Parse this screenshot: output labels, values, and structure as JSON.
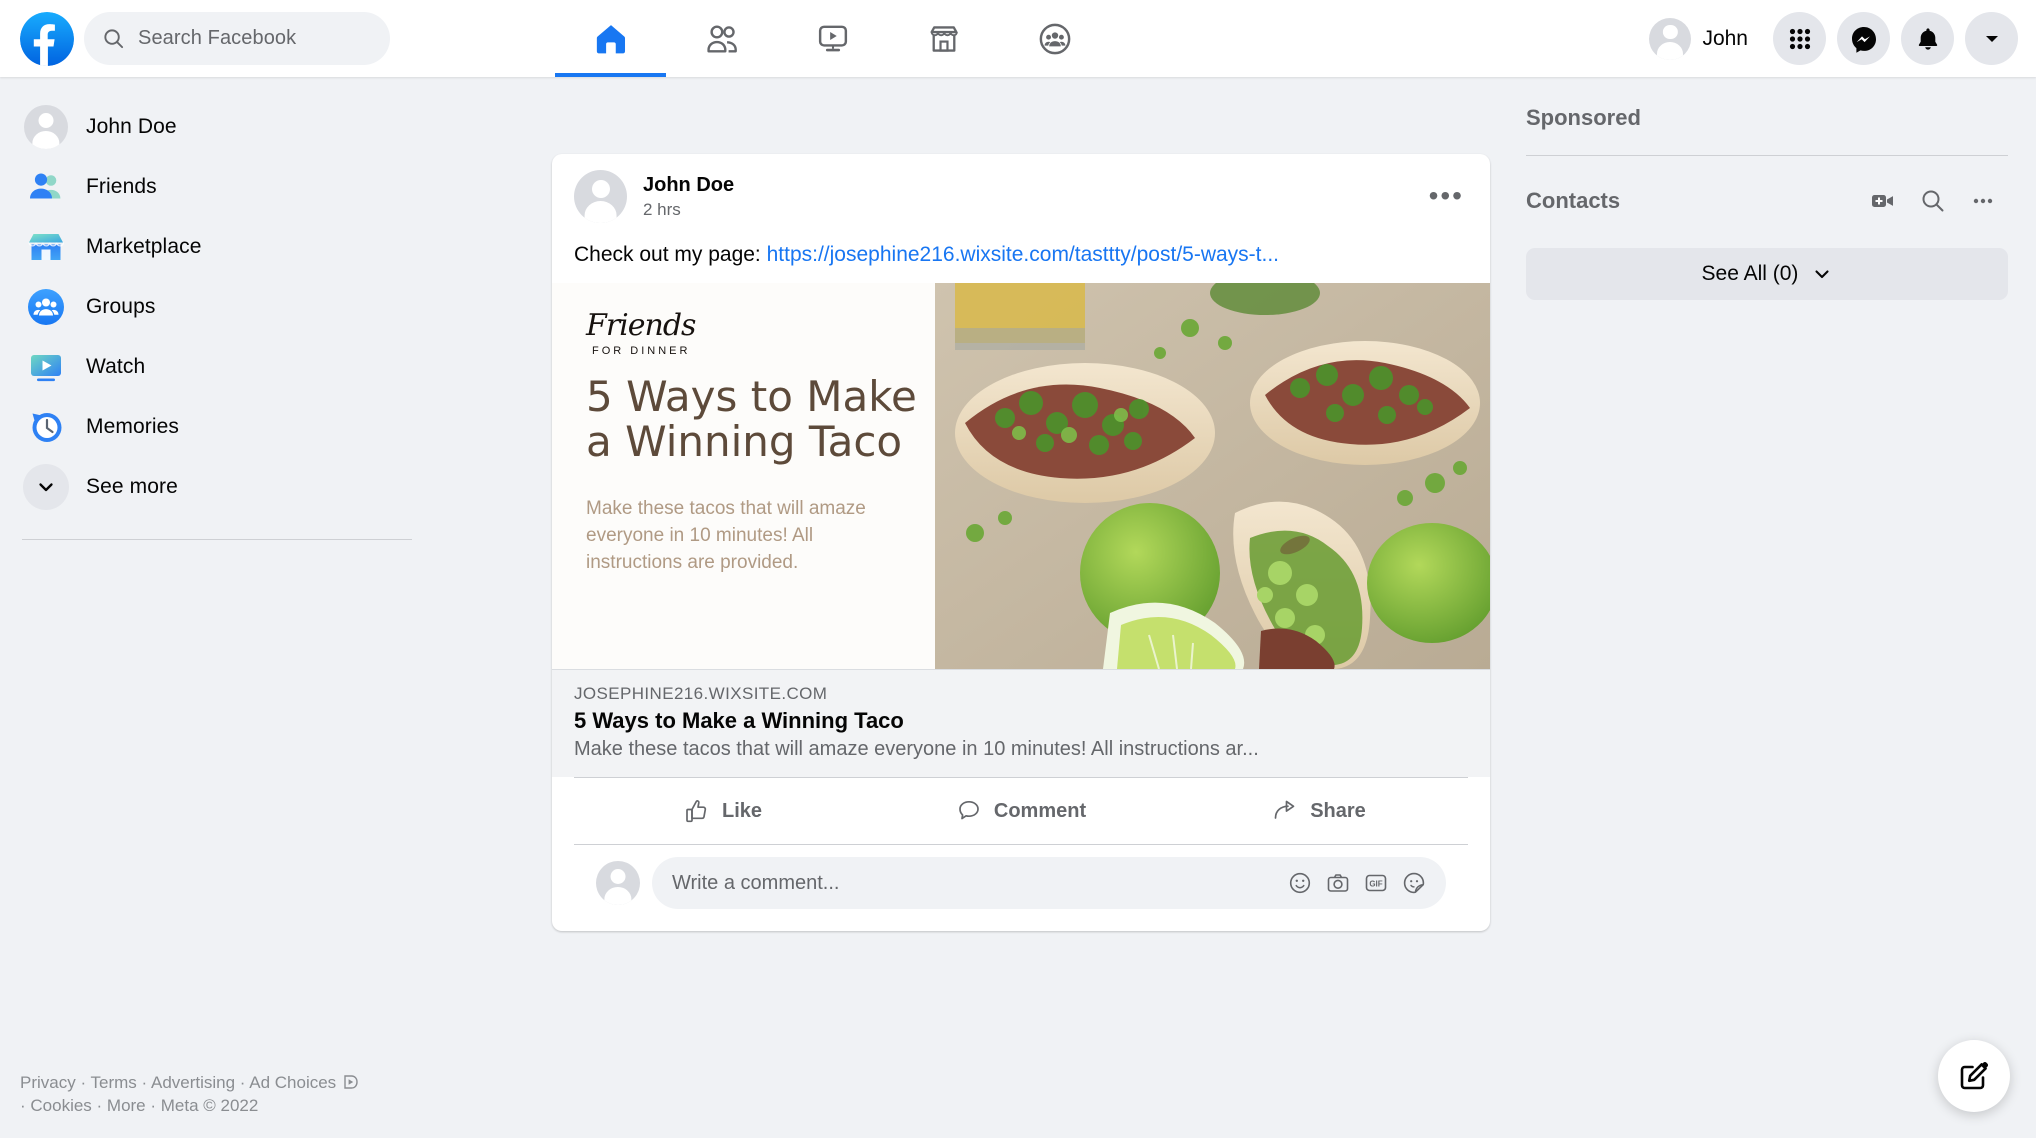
{
  "header": {
    "logo_icon": "facebook-logo",
    "search": {
      "icon": "search-icon",
      "placeholder": "Search Facebook",
      "value": ""
    },
    "nav_tabs": [
      {
        "name": "home",
        "icon": "home-icon",
        "active": true
      },
      {
        "name": "friends",
        "icon": "friends-icon",
        "active": false
      },
      {
        "name": "watch",
        "icon": "watch-icon",
        "active": false
      },
      {
        "name": "marketplace",
        "icon": "marketplace-icon",
        "active": false
      },
      {
        "name": "groups",
        "icon": "groups-icon",
        "active": false
      }
    ],
    "profile_name": "John",
    "right_buttons": [
      {
        "name": "menu-grid",
        "icon": "grid-icon"
      },
      {
        "name": "messenger",
        "icon": "messenger-icon"
      },
      {
        "name": "notifications",
        "icon": "bell-icon"
      },
      {
        "name": "account",
        "icon": "chevron-down-icon"
      }
    ]
  },
  "sidebar": {
    "items": [
      {
        "label": "John Doe",
        "icon": "avatar-icon"
      },
      {
        "label": "Friends",
        "icon": "friends-icon"
      },
      {
        "label": "Marketplace",
        "icon": "marketplace-icon"
      },
      {
        "label": "Groups",
        "icon": "groups-icon"
      },
      {
        "label": "Watch",
        "icon": "watch-icon"
      },
      {
        "label": "Memories",
        "icon": "memories-clock-icon"
      },
      {
        "label": "See more",
        "icon": "chevron-down-icon"
      }
    ]
  },
  "footer": {
    "line1": "Privacy · Terms · Advertising · Ad Choices",
    "adchoices_icon": "adchoices-icon",
    "line2": "· Cookies · More · Meta © 2022"
  },
  "post": {
    "author": "John Doe",
    "time": "2 hrs",
    "menu_icon": "ellipsis-icon",
    "text_prefix": "Check out my page: ",
    "link_text": "https://josephine216.wixsite.com/tasttty/post/5-ways-t...",
    "link_preview": {
      "brand_script": "Friends",
      "brand_sub": "FOR DINNER",
      "headline": "5 Ways to Make a Winning Taco",
      "description": "Make these tacos that will amaze everyone in 10 minutes! All instructions are provided.",
      "photo_alt": "steak tacos with lime wedges on parchment paper",
      "domain": "JOSEPHINE216.WIXSITE.COM",
      "footer_title": "5 Ways to Make a Winning Taco",
      "footer_desc": "Make these tacos that will amaze everyone in 10 minutes! All instructions ar..."
    },
    "actions": [
      {
        "label": "Like",
        "icon": "thumbs-up-icon"
      },
      {
        "label": "Comment",
        "icon": "comment-bubble-icon"
      },
      {
        "label": "Share",
        "icon": "share-arrow-icon"
      }
    ],
    "comment_placeholder": "Write a comment...",
    "comment_value": "",
    "comment_icons": [
      {
        "name": "emoji-icon"
      },
      {
        "name": "camera-icon"
      },
      {
        "name": "gif-icon"
      },
      {
        "name": "sticker-icon"
      }
    ]
  },
  "right_panel": {
    "sponsored_title": "Sponsored",
    "contacts_title": "Contacts",
    "contacts_actions": [
      {
        "name": "video-room-icon"
      },
      {
        "name": "search-icon"
      },
      {
        "name": "ellipsis-icon"
      }
    ],
    "see_all_label": "See All (0)",
    "see_all_chevron": "chevron-down-icon"
  },
  "fab": {
    "icon": "compose-pencil-icon"
  },
  "colors": {
    "brand_blue": "#1877f2",
    "link_blue": "#1876f2",
    "page_bg": "#f0f2f5",
    "card_bg": "#ffffff",
    "text_primary": "#050505",
    "text_secondary": "#65676b",
    "preview_brown": "#5d4a3a",
    "preview_tan": "#b09a84"
  }
}
